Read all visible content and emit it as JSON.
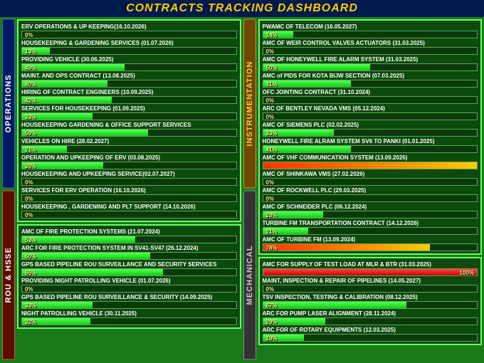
{
  "title": "CONTRACTS TRACKING DASHBOARD",
  "tabs": {
    "ops": "OPERATIONS",
    "rou": "ROU & HSSE",
    "instr": "INSTRUMENTATION",
    "mech": "MECHANICAL"
  },
  "ops": [
    {
      "t": "ERV OPERATIONS & UP KEEPING(16.10.2026)",
      "p": 0
    },
    {
      "t": "HOUSEKEEPING & GARDENING SERVICES (01.07.2026)",
      "p": 13
    },
    {
      "t": "PROVIDING VEHICLE (30.06.2025)",
      "p": 48
    },
    {
      "t": "MAINT. AND OPS CONTRACT (13.08.2025)",
      "p": 40
    },
    {
      "t": "HIRING OF CONTRACT ENGINEERS  (10.09.2025)",
      "p": 42
    },
    {
      "t": "SERVICES FOR HOUSEKEEPING (01.09.2025)",
      "p": 33
    },
    {
      "t": "HOUSEKEEPING  GARDENING & OFFICE SUPPORT SERVICES",
      "p": 59
    },
    {
      "t": "VEHICLES ON HIRE (28.02.2027)",
      "p": 21
    },
    {
      "t": "OPERATION AND UPKEEPING OF ERV (03.08.2025)",
      "p": 38
    },
    {
      "t": "HOUSEKEEPING AND UPKEEPING SERVICE(02.07.2027)",
      "p": 0
    },
    {
      "t": "SERVICES FOR ERV OPERATION (16.10.2026)",
      "p": 0
    },
    {
      "t": "HOUSEKEEPING , GARDENING AND PLT SUPPORT (14.10.2026)",
      "p": 0
    }
  ],
  "rou": [
    {
      "t": "AMC OF FIRE PROTECTION SYSTEMS  (21.07.2024)",
      "p": 53
    },
    {
      "t": "ARC FOR FIRE PROTECTION SYSTEM IN SV41-SV47 (26.12.2024)",
      "p": 60
    },
    {
      "t": "GPS BASED PIPELINE ROU SURVEILLANCE AND SECURITY SERVICES",
      "p": 66
    },
    {
      "t": "PROVIDING NIGHT PATROLLING VEHICLE (01.07.2026)",
      "p": 0
    },
    {
      "t": "GPS BASED PIPELINE ROU SURVEILLANCE & SECURITY  (14.09.2025)",
      "p": 33
    },
    {
      "t": "NIGHT PATROLLING VEHICLE (30.11.2025)",
      "p": 32
    }
  ],
  "instr": [
    {
      "t": "PWAMC OF TELECOM (16.05.2027)",
      "p": 14
    },
    {
      "t": "AMC OF WEIR CONTROL VALVES ACTUATORS (31.03.2025)",
      "p": 0
    },
    {
      "t": "AMC OF HONEYWELL FIRE ALARM SYSTEM (31.03.2025)",
      "p": 50
    },
    {
      "t": "AMC of PIDS FOR KOTA BIJW SECTION (07.03.2025)",
      "p": 41
    },
    {
      "t": "OFC JOINTING CONTRACT (31.10.2024)",
      "p": 0
    },
    {
      "t": "ARC OF BENTLEY NEVADA VMS (05.12.2024)",
      "p": 0
    },
    {
      "t": "AMC OF SIEMENS PLC (02.02.2025)",
      "p": 33
    },
    {
      "t": "HONEYWELL FIRE ALRAM SYSTEM SV6 TO PANKI (01.01.2025)",
      "p": 41
    },
    {
      "t": "AMC OF VHF COMMUNICATION SYSTEM (13.09.2026)",
      "p": 100,
      "color": "hot",
      "hidepct": true
    },
    {
      "t": "AMC OF SHINKAWA VMS (27.02.2026)",
      "p": 0
    },
    {
      "t": "AMC OF ROCKWELL PLC (29.03.2025)",
      "p": 0
    },
    {
      "t": "AMC OF SCHNEIDER PLC (06.12.2024)",
      "p": 28
    },
    {
      "t": "TURBINE FM TRANSPORTATION CONTRACT (14.12.2026)",
      "p": 21
    },
    {
      "t": "AMC OF TURBINE FM (13.09.2024)",
      "p": 78,
      "color": "hot"
    }
  ],
  "mech": [
    {
      "t": "AMC FOR SUPPLY OF TEST LOAD AT MLR & BTR (31.03.2025)",
      "p": 100,
      "color": "red",
      "right": true
    },
    {
      "t": "MAINT, INSPECTION & REPAIR OF PIPELINES (14.05.2027)",
      "p": 0
    },
    {
      "t": "TSV INSPECTION, TESTING & CALIBRATION (08.12.2025)",
      "p": 67
    },
    {
      "t": "ARC FOR PUMP LASER ALIGNMENT (28.11.2024)",
      "p": 29
    },
    {
      "t": "ARC FOR OF ROTARY EQUIPMENTS (12.03.2025)",
      "p": 19
    }
  ]
}
